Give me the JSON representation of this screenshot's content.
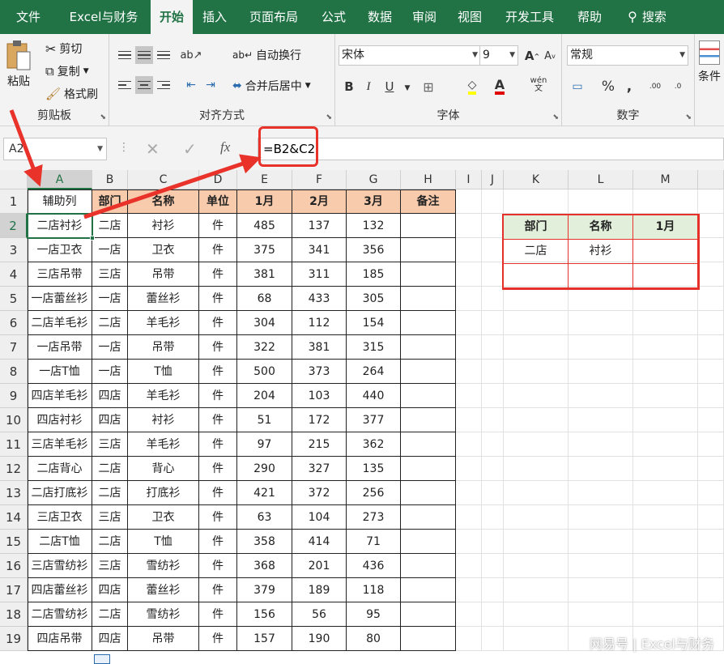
{
  "tabs": [
    "文件",
    "Excel与财务",
    "开始",
    "插入",
    "页面布局",
    "公式",
    "数据",
    "审阅",
    "视图",
    "开发工具",
    "帮助",
    "搜索"
  ],
  "ribbon": {
    "clipboard": {
      "label": "剪贴板",
      "paste": "粘贴",
      "cut": "剪切",
      "copy": "复制",
      "format_painter": "格式刷"
    },
    "alignment": {
      "label": "对齐方式",
      "wrap": "自动换行",
      "merge": "合并后居中"
    },
    "font": {
      "label": "字体",
      "name": "宋体",
      "size": "9",
      "bold": "B",
      "italic": "I",
      "underline": "U",
      "grow": "A",
      "shrink": "A",
      "color_a": "A",
      "phonetic": "wén\n文"
    },
    "number": {
      "label": "数字",
      "format": "常规",
      "percent": "%",
      "comma": ",",
      "inc": ".00",
      "dec": ".0"
    },
    "styles": {
      "cond": "条件"
    }
  },
  "formula_bar": {
    "name_box": "A2",
    "formula": "=B2&C2",
    "fx": "fx"
  },
  "columns": [
    "A",
    "B",
    "C",
    "D",
    "E",
    "F",
    "G",
    "H",
    "I",
    "J",
    "K",
    "L",
    "M"
  ],
  "rows": [
    "1",
    "2",
    "3",
    "4",
    "5",
    "6",
    "7",
    "8",
    "9",
    "10",
    "11",
    "12",
    "13",
    "14",
    "15",
    "16",
    "17",
    "18",
    "19"
  ],
  "table": {
    "headers": [
      "辅助列",
      "部门",
      "名称",
      "单位",
      "1月",
      "2月",
      "3月",
      "备注"
    ],
    "rows": [
      [
        "二店衬衫",
        "二店",
        "衬衫",
        "件",
        "485",
        "137",
        "132",
        ""
      ],
      [
        "一店卫衣",
        "一店",
        "卫衣",
        "件",
        "375",
        "341",
        "356",
        ""
      ],
      [
        "三店吊带",
        "三店",
        "吊带",
        "件",
        "381",
        "311",
        "185",
        ""
      ],
      [
        "一店蕾丝衫",
        "一店",
        "蕾丝衫",
        "件",
        "68",
        "433",
        "305",
        ""
      ],
      [
        "二店羊毛衫",
        "二店",
        "羊毛衫",
        "件",
        "304",
        "112",
        "154",
        ""
      ],
      [
        "一店吊带",
        "一店",
        "吊带",
        "件",
        "322",
        "381",
        "315",
        ""
      ],
      [
        "一店T恤",
        "一店",
        "T恤",
        "件",
        "500",
        "373",
        "264",
        ""
      ],
      [
        "四店羊毛衫",
        "四店",
        "羊毛衫",
        "件",
        "204",
        "103",
        "440",
        ""
      ],
      [
        "四店衬衫",
        "四店",
        "衬衫",
        "件",
        "51",
        "172",
        "377",
        ""
      ],
      [
        "三店羊毛衫",
        "三店",
        "羊毛衫",
        "件",
        "97",
        "215",
        "362",
        ""
      ],
      [
        "二店背心",
        "二店",
        "背心",
        "件",
        "290",
        "327",
        "135",
        ""
      ],
      [
        "二店打底衫",
        "二店",
        "打底衫",
        "件",
        "421",
        "372",
        "256",
        ""
      ],
      [
        "三店卫衣",
        "三店",
        "卫衣",
        "件",
        "63",
        "104",
        "273",
        ""
      ],
      [
        "二店T恤",
        "二店",
        "T恤",
        "件",
        "358",
        "414",
        "71",
        ""
      ],
      [
        "三店雪纺衫",
        "三店",
        "雪纺衫",
        "件",
        "368",
        "201",
        "436",
        ""
      ],
      [
        "四店蕾丝衫",
        "四店",
        "蕾丝衫",
        "件",
        "379",
        "189",
        "118",
        ""
      ],
      [
        "二店雪纺衫",
        "二店",
        "雪纺衫",
        "件",
        "156",
        "56",
        "95",
        ""
      ],
      [
        "四店吊带",
        "四店",
        "吊带",
        "件",
        "157",
        "190",
        "80",
        ""
      ]
    ]
  },
  "lookup": {
    "headers": [
      "部门",
      "名称",
      "1月"
    ],
    "rows": [
      [
        "二店",
        "衬衫",
        ""
      ],
      [
        "",
        "",
        ""
      ]
    ]
  },
  "watermark": "网易号 | Excel与财务",
  "colors": {
    "accent": "#217346",
    "header_fill": "#f8cbad",
    "lookup_header_fill": "#e2efda",
    "annotation": "#e8322a"
  }
}
